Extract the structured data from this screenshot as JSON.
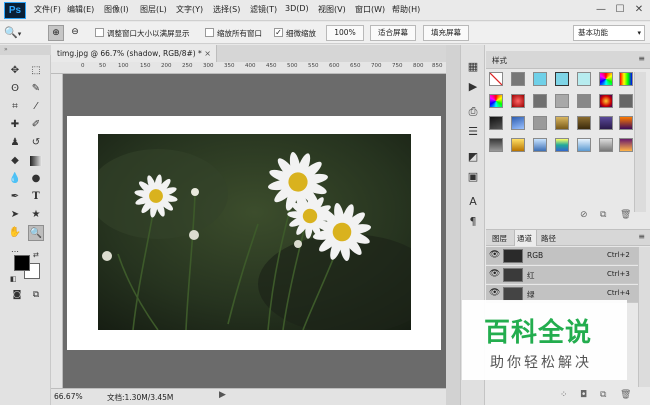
{
  "app": {
    "logo_text": "Ps",
    "menu": [
      "文件(F)",
      "编辑(E)",
      "图像(I)",
      "图层(L)",
      "文字(Y)",
      "选择(S)",
      "滤镜(T)",
      "3D(D)",
      "视图(V)",
      "窗口(W)",
      "帮助(H)"
    ],
    "window_controls": {
      "minimize": "—",
      "maximize": "☐",
      "close": "✕"
    }
  },
  "options_bar": {
    "tool_icon": "zoom-icon",
    "resize_windows_label": "调整窗口大小以满屏显示",
    "zoom_all_windows_label": "缩放所有窗口",
    "scrubby_zoom_label": "细微缩放",
    "scrubby_zoom_checked": true,
    "zoom_100_label": "100%",
    "fit_screen_label": "适合屏幕",
    "fill_screen_label": "填充屏幕",
    "workspace_label": "基本功能"
  },
  "document": {
    "tab_title": "timg.jpg @ 66.7% (shadow, RGB/8#) *",
    "tab_close": "×",
    "ruler_numbers": [
      "0",
      "50",
      "100",
      "150",
      "200",
      "250",
      "300",
      "350",
      "400",
      "450",
      "500",
      "550",
      "600",
      "650",
      "700",
      "750",
      "800",
      "850",
      "900"
    ]
  },
  "status_bar": {
    "zoom": "66.67%",
    "doc_size": "文档:1.30M/3.45M",
    "arrow": "▶"
  },
  "styles_panel": {
    "tab_label": "样式",
    "menu_icon": "≡"
  },
  "channels_panel": {
    "tabs": [
      "图层",
      "通道",
      "路径"
    ],
    "active_tab": "通道",
    "channels": [
      {
        "name": "RGB",
        "shortcut": "Ctrl+2"
      },
      {
        "name": "红",
        "shortcut": "Ctrl+3"
      },
      {
        "name": "绿",
        "shortcut": "Ctrl+4"
      }
    ]
  },
  "colors": {
    "foreground": "#000000",
    "background": "#ffffff",
    "watermark_green": "#23ad4e"
  },
  "watermark": {
    "title": "百科全说",
    "subtitle": "助你轻松解决"
  }
}
